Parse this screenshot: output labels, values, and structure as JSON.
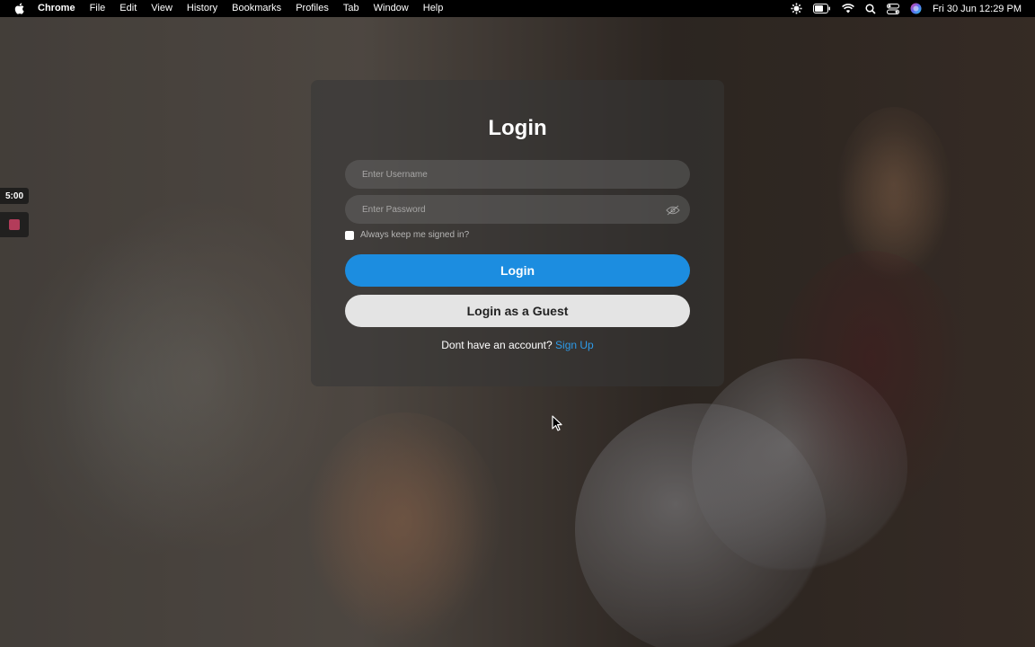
{
  "menubar": {
    "app_name": "Chrome",
    "menus": [
      "File",
      "Edit",
      "View",
      "History",
      "Bookmarks",
      "Profiles",
      "Tab",
      "Window",
      "Help"
    ],
    "clock": "Fri 30 Jun  12:29 PM",
    "status_icons": [
      "settings-icon",
      "battery-icon",
      "wifi-icon",
      "search-icon",
      "control-center-icon",
      "siri-icon"
    ]
  },
  "widget": {
    "timer": "5:00"
  },
  "login": {
    "title": "Login",
    "username_placeholder": "Enter Username",
    "password_placeholder": "Enter Password",
    "remember_label": "Always keep me signed in?",
    "login_button": "Login",
    "guest_button": "Login as a Guest",
    "no_account_text": "Dont have an account?",
    "signup_link": "Sign Up"
  },
  "colors": {
    "primary": "#1c8de0",
    "link": "#2d9be9",
    "guest_button_bg": "#e4e4e4"
  }
}
